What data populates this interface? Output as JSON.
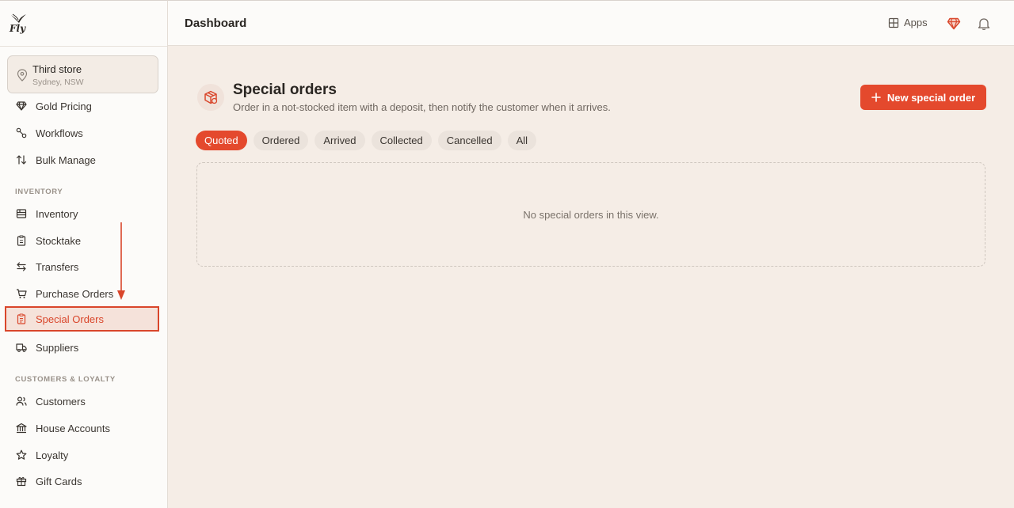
{
  "brand": {
    "logo_text": "Fly"
  },
  "store": {
    "name": "Third store",
    "location": "Sydney, NSW"
  },
  "sidebar": {
    "items_top": [
      {
        "label": "Gold Pricing",
        "icon": "gem-icon"
      },
      {
        "label": "Workflows",
        "icon": "workflow-icon"
      },
      {
        "label": "Bulk Manage",
        "icon": "sort-arrows-icon"
      }
    ],
    "inventory_label": "INVENTORY",
    "inventory_items": [
      {
        "label": "Inventory",
        "icon": "boxes-icon"
      },
      {
        "label": "Stocktake",
        "icon": "clipboard-icon"
      },
      {
        "label": "Transfers",
        "icon": "transfer-icon"
      },
      {
        "label": "Purchase Orders",
        "icon": "cart-icon"
      },
      {
        "label": "Special Orders",
        "icon": "clipboard-list-icon",
        "active": true
      },
      {
        "label": "Suppliers",
        "icon": "truck-icon"
      }
    ],
    "customers_label": "CUSTOMERS & LOYALTY",
    "customers_items": [
      {
        "label": "Customers",
        "icon": "users-icon"
      },
      {
        "label": "House Accounts",
        "icon": "bank-icon"
      },
      {
        "label": "Loyalty",
        "icon": "star-icon"
      },
      {
        "label": "Gift Cards",
        "icon": "gift-icon"
      }
    ]
  },
  "header": {
    "title": "Dashboard",
    "apps_label": "Apps"
  },
  "main": {
    "title": "Special orders",
    "subtitle": "Order in a not-stocked item with a deposit, then notify the customer when it arrives.",
    "new_button": "New special order",
    "tabs": [
      "Quoted",
      "Ordered",
      "Arrived",
      "Collected",
      "Cancelled",
      "All"
    ],
    "active_tab": "Quoted",
    "empty_message": "No special orders in this view."
  },
  "colors": {
    "accent": "#e4492d",
    "background": "#f5ede6",
    "sidebar": "#fcfbf9"
  }
}
